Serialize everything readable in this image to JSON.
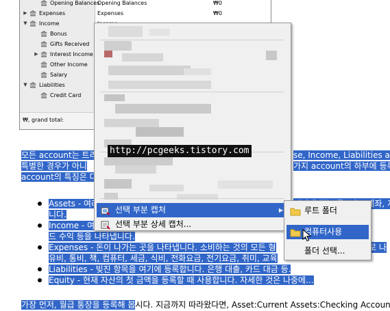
{
  "tree": {
    "rows": [
      {
        "name": "Opening Balances",
        "desc": "Opening Balances",
        "amount": "",
        "expander": "",
        "level": 2
      },
      {
        "name": "Expenses",
        "desc": "Expenses",
        "amount": "₩0",
        "expander": "▶",
        "level": 0
      },
      {
        "name": "Income",
        "desc": "Income",
        "amount": "",
        "expander": "▼",
        "level": 0
      },
      {
        "name": "Bonus",
        "desc": "",
        "amount": "",
        "expander": "",
        "level": 1
      },
      {
        "name": "Gifts Received",
        "desc": "",
        "amount": "",
        "expander": "",
        "level": 1
      },
      {
        "name": "Interest Income",
        "desc": "",
        "amount": "",
        "expander": "▶",
        "level": 1
      },
      {
        "name": "Other Income",
        "desc": "",
        "amount": "",
        "expander": "",
        "level": 1
      },
      {
        "name": "Salary",
        "desc": "",
        "amount": "",
        "expander": "",
        "level": 1
      },
      {
        "name": "Liabilities",
        "desc": "",
        "amount": "",
        "expander": "▼",
        "level": 0
      },
      {
        "name": "Credit Card",
        "desc": "",
        "amount": "",
        "expander": "",
        "level": 1
      }
    ],
    "opening_amount": "₩0",
    "grand_total_label": "₩, grand total:"
  },
  "document": {
    "intro_line1": "모든 account는 트리",
    "intro_line1_right": "se, Income, Liabilities accou",
    "intro_line2": "특별한 경우가 아니",
    "intro_line2_right": "가지 account의 하부에 등록",
    "intro_line3": "account의 특징은 다",
    "bullets": [
      {
        "first": "Assets - 여러",
        "first_right": "기지에 있는 돈, 펀드 계좌, 저",
        "second": "니다."
      },
      {
        "first": "Income - 여러",
        "first_right": "부모님",
        "second": "드 수익 등을 나타냅니다."
      },
      {
        "first": "Expenses - 돈이 나가는 곳을 나타냅니다. 소비하는 것의 모든 형",
        "first_right": "로 나",
        "second": "유비, 통비, 책, 컴퓨터, 세금, 식비, 전화요금, 전기요금, 취미, 교육"
      },
      {
        "first": "Liabilities - 빚진 항목을 여기에 등록합니다. 은행 대출, 카드 대금 등.",
        "first_right": "",
        "second": ""
      },
      {
        "first": "Equity - 현재 자산의 첫 금액을 등록할 때 사용합니다. 자세한 것은 나중에...",
        "first_right": "",
        "second": ""
      }
    ],
    "last_line_hl": "가장 먼저, 월급 통장을 등록해 봅",
    "last_line_rest": "시다. 지금까지 따라왔다면, Asset:Current Assets:Checking Account"
  },
  "context_menu": {
    "watermark": "http://pcgeeks.tistory.com",
    "items": [
      {
        "label": "선택 부분 캡처",
        "icon": "capture-icon",
        "has_submenu": true
      },
      {
        "label": "선택 부분 상세 캡처...",
        "icon": "detail-capture-icon",
        "has_submenu": false
      }
    ]
  },
  "submenu": {
    "items": [
      {
        "label": "루트 폴더",
        "icon": "folder-icon"
      },
      {
        "label": "컴퓨터사용",
        "icon": "folder-icon"
      },
      {
        "label": "폴더 선택...",
        "icon": ""
      }
    ]
  },
  "colors": {
    "selection": "#3166c8",
    "menu_bg": "#f0f0f0",
    "folder": "#f2c94c"
  }
}
